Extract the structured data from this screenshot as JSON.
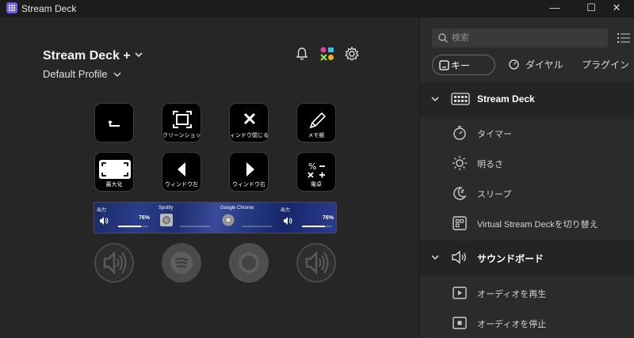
{
  "window": {
    "title": "Stream Deck",
    "controls": {
      "minimize": "—",
      "maximize": "☐",
      "close": "✕"
    }
  },
  "device": {
    "name": "Stream Deck +",
    "profile": "Default Profile"
  },
  "header_icons": [
    "bell-icon",
    "marketplace-icon",
    "gear-icon"
  ],
  "keys": [
    {
      "label": "",
      "icon": "back-arrow-icon"
    },
    {
      "label": "クリーンショット",
      "icon": "screenshot-icon"
    },
    {
      "label": "ィンドウ閉じる",
      "icon": "close-window-icon"
    },
    {
      "label": "メモ帳",
      "icon": "pencil-icon"
    },
    {
      "label": "最大化",
      "icon": "maximize-icon"
    },
    {
      "label": "ウィンドウ左",
      "icon": "left-arrow-icon"
    },
    {
      "label": "ウィンドウ右",
      "icon": "right-arrow-icon"
    },
    {
      "label": "電卓",
      "icon": "calculator-icon"
    }
  ],
  "touch_strip": [
    {
      "title": "出力",
      "value": "76%",
      "level": 0.76,
      "icon": "speaker-icon"
    },
    {
      "title": "Spotify",
      "value": "",
      "level": 0.0,
      "icon": "spotify-icon"
    },
    {
      "title": "Google Chrome",
      "value": "",
      "level": 0.0,
      "icon": "chrome-icon"
    },
    {
      "title": "出力",
      "value": "76%",
      "level": 0.76,
      "icon": "speaker-icon"
    }
  ],
  "dials": [
    "volume-dial-icon",
    "spotify-dial-icon",
    "chrome-dial-icon",
    "volume-dial-icon"
  ],
  "sidebar": {
    "search_placeholder": "検索",
    "tabs": [
      {
        "label": "キー",
        "active": true
      },
      {
        "label": "ダイヤル",
        "active": false
      },
      {
        "label": "プラグイン",
        "active": false
      }
    ],
    "categories": [
      {
        "label": "Stream Deck",
        "actions": [
          {
            "label": "タイマー",
            "icon": "timer-icon"
          },
          {
            "label": "明るさ",
            "icon": "brightness-icon"
          },
          {
            "label": "スリープ",
            "icon": "sleep-icon"
          },
          {
            "label": "Virtual Stream Deckを切り替え",
            "icon": "virtual-deck-icon"
          }
        ]
      },
      {
        "label": "サウンドボード",
        "actions": [
          {
            "label": "オーディオを再生",
            "icon": "play-audio-icon"
          },
          {
            "label": "オーディオを停止",
            "icon": "stop-audio-icon"
          }
        ]
      }
    ]
  },
  "colors": {
    "accent": "#6d5cf0",
    "background": "#232323",
    "panel": "#2b2b2b"
  }
}
